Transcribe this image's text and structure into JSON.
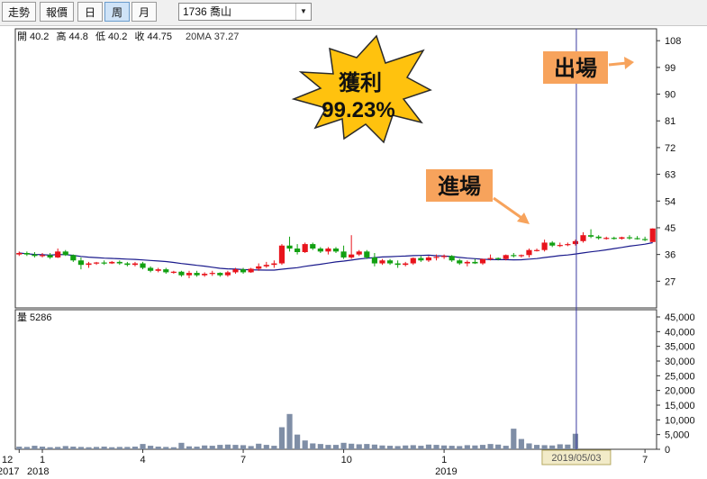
{
  "toolbar": {
    "buttons": [
      "走勢",
      "報價",
      "日",
      "周",
      "月"
    ],
    "active": "周",
    "stock": "1736 喬山"
  },
  "info": {
    "open_label": "開",
    "open": "40.2",
    "high_label": "高",
    "high": "44.8",
    "low_label": "低",
    "low": "40.2",
    "close_label": "收",
    "close": "44.75",
    "ma_label": "20MA",
    "ma": "37.27"
  },
  "volume_info": {
    "label": "量",
    "value": "5286"
  },
  "annotations": {
    "profit_line1": "獲利",
    "profit_line2": "99.23%",
    "entry": "進場",
    "exit": "出場",
    "crosshair_date": "2019/05/03"
  },
  "colors": {
    "up": "#e8141c",
    "down": "#12a012",
    "ma": "#1a1a8c",
    "volume": "#7f8ea6",
    "burst": "#ffc20e",
    "label_box": "#f7a35c",
    "crosshair": "#3a3aa0"
  },
  "chart_data": {
    "type": "candlestick",
    "period": "weekly",
    "price_axis": {
      "ylim": [
        18,
        112
      ],
      "ticks": [
        "108",
        "99",
        "90",
        "81",
        "72",
        "63",
        "54",
        "45",
        "36",
        "27"
      ]
    },
    "volume_axis": {
      "ylim": [
        0,
        45000
      ],
      "ticks": [
        "45,000",
        "40,000",
        "35,000",
        "30,000",
        "25,000",
        "20,000",
        "15,000",
        "10,000",
        "5,000",
        "0"
      ]
    },
    "x_labels": [
      {
        "label": "12",
        "bar": 0
      },
      {
        "label": "1",
        "bar": 3
      },
      {
        "label": "4",
        "bar": 16
      },
      {
        "label": "7",
        "bar": 29
      },
      {
        "label": "10",
        "bar": 42
      },
      {
        "label": "1",
        "bar": 55
      },
      {
        "label": "4",
        "bar": 68
      },
      {
        "label": "7",
        "bar": 81
      }
    ],
    "year_labels": [
      {
        "label": "2017",
        "bar": 0
      },
      {
        "label": "2018",
        "bar": 3
      },
      {
        "label": "2019",
        "bar": 55
      }
    ],
    "crosshair_bar": 72,
    "candles": [
      [
        36,
        37,
        35.5,
        36.5
      ],
      [
        36.5,
        37,
        35.5,
        36
      ],
      [
        36,
        36.8,
        35,
        35.5
      ],
      [
        35.5,
        36.5,
        35,
        35.8
      ],
      [
        35.8,
        36.5,
        34.5,
        35
      ],
      [
        35,
        38,
        34.8,
        37
      ],
      [
        37,
        37.5,
        35.5,
        35.8
      ],
      [
        35.8,
        36,
        33.5,
        34
      ],
      [
        34,
        35,
        31,
        32.5
      ],
      [
        32.5,
        33.5,
        31.5,
        33
      ],
      [
        33,
        33.5,
        32.5,
        33.3
      ],
      [
        33.3,
        34,
        32.5,
        33
      ],
      [
        33,
        33.8,
        32.8,
        33.5
      ],
      [
        33.5,
        34,
        32.5,
        33
      ],
      [
        33,
        33.5,
        32,
        32.5
      ],
      [
        32.5,
        33.5,
        32,
        33
      ],
      [
        33,
        33.5,
        31,
        31.5
      ],
      [
        31.5,
        32,
        30,
        30.5
      ],
      [
        30.5,
        31.5,
        30,
        31
      ],
      [
        31,
        31.5,
        29.5,
        30
      ],
      [
        30,
        30.5,
        29.5,
        30.2
      ],
      [
        30.2,
        30.5,
        28.5,
        29
      ],
      [
        29,
        30.5,
        28,
        29.8
      ],
      [
        29.8,
        30.5,
        28.5,
        29
      ],
      [
        29,
        30,
        28.5,
        29.5
      ],
      [
        29.5,
        30.5,
        28.8,
        29.8
      ],
      [
        29.8,
        30,
        28.5,
        29
      ],
      [
        29,
        30.5,
        28.5,
        30
      ],
      [
        30,
        31.5,
        29.5,
        31
      ],
      [
        31,
        31.5,
        29.5,
        30
      ],
      [
        30,
        31.5,
        29.8,
        31.2
      ],
      [
        31.2,
        33,
        30.5,
        32
      ],
      [
        32,
        33.5,
        31.5,
        32.5
      ],
      [
        32.5,
        34,
        31.5,
        33
      ],
      [
        33,
        39.5,
        32.5,
        39
      ],
      [
        39,
        42,
        37,
        38
      ],
      [
        38,
        39.5,
        36,
        36.8
      ],
      [
        36.8,
        40,
        36.5,
        39.5
      ],
      [
        39.5,
        40,
        37.5,
        38
      ],
      [
        38,
        38.5,
        36.5,
        37
      ],
      [
        37,
        38.5,
        36,
        38
      ],
      [
        38,
        38.5,
        36.5,
        37
      ],
      [
        37,
        39,
        34.5,
        35
      ],
      [
        35,
        42.5,
        34.5,
        36
      ],
      [
        36,
        37.5,
        35.5,
        37
      ],
      [
        37,
        37.5,
        34.5,
        35
      ],
      [
        35,
        36.5,
        32,
        33
      ],
      [
        33,
        34.5,
        32.5,
        34
      ],
      [
        34,
        34.5,
        32.5,
        33
      ],
      [
        33,
        34,
        31.5,
        32.5
      ],
      [
        32.5,
        33.5,
        32,
        33
      ],
      [
        33,
        35,
        32.5,
        34.8
      ],
      [
        34.8,
        35.5,
        33.5,
        34
      ],
      [
        34,
        35.5,
        33.5,
        35
      ],
      [
        35,
        36,
        34,
        35.2
      ],
      [
        35.2,
        36,
        34.5,
        35.5
      ],
      [
        35.5,
        35.8,
        33.5,
        34
      ],
      [
        34,
        34.5,
        32.5,
        33
      ],
      [
        33,
        34,
        32,
        33.5
      ],
      [
        33.5,
        34.5,
        32.8,
        33
      ],
      [
        33,
        34.5,
        32.5,
        34.5
      ],
      [
        34.5,
        36,
        34,
        34.8
      ],
      [
        34.8,
        35,
        34,
        34.5
      ],
      [
        34.5,
        36,
        34,
        35.8
      ],
      [
        35.8,
        36.5,
        35,
        35.5
      ],
      [
        35.5,
        36,
        35,
        35.8
      ],
      [
        35.8,
        38,
        35,
        37.5
      ],
      [
        37.5,
        38,
        37,
        37.5
      ],
      [
        37.5,
        41,
        37,
        40
      ],
      [
        40,
        40.5,
        38.5,
        39
      ],
      [
        39,
        40,
        38.5,
        39.2
      ],
      [
        39.2,
        40,
        38.8,
        39.5
      ],
      [
        39.5,
        41,
        39,
        40.5
      ],
      [
        40.5,
        43.5,
        40,
        42.5
      ],
      [
        42.5,
        44.5,
        41.5,
        42
      ],
      [
        42,
        42.5,
        41,
        41.5
      ],
      [
        41.5,
        42,
        41,
        41.6
      ],
      [
        41.6,
        42,
        41,
        41.3
      ],
      [
        41.3,
        42,
        41,
        41.8
      ],
      [
        41.8,
        42.5,
        41,
        41.5
      ],
      [
        41.5,
        42.2,
        41,
        41.2
      ],
      [
        41.2,
        42,
        40.5,
        41
      ],
      [
        40.2,
        44.8,
        40.2,
        44.75
      ]
    ],
    "ma20": "computed from closes of preceding weekly bars",
    "volume": [
      900,
      800,
      1200,
      900,
      700,
      800,
      1100,
      900,
      800,
      700,
      800,
      900,
      700,
      800,
      800,
      900,
      1800,
      1200,
      900,
      800,
      700,
      2200,
      1000,
      900,
      1300,
      1200,
      1500,
      1600,
      1500,
      1400,
      1100,
      1900,
      1500,
      1200,
      7500,
      12000,
      5000,
      3000,
      2000,
      1800,
      1500,
      1500,
      2200,
      1900,
      1700,
      1800,
      1600,
      1300,
      1200,
      1100,
      1300,
      1400,
      1200,
      1600,
      1500,
      1300,
      1200,
      1100,
      1400,
      1300,
      1500,
      1800,
      1600,
      1200,
      7000,
      3500,
      2000,
      1500,
      1400,
      1300,
      1700,
      1600,
      5286
    ]
  }
}
